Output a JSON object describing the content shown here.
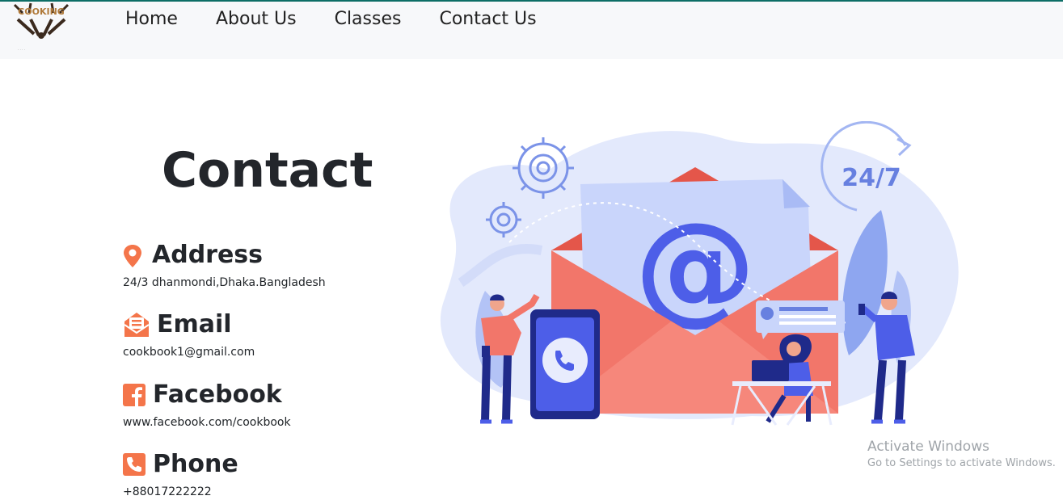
{
  "nav": {
    "logo_text": "COOKING",
    "links": [
      "Home",
      "About Us",
      "Classes",
      "Contact Us"
    ]
  },
  "contact": {
    "title": "Contact",
    "items": [
      {
        "icon": "map-pin-icon",
        "title": "Address",
        "text": "24/3 dhanmondi,Dhaka.Bangladesh"
      },
      {
        "icon": "envelope-icon",
        "title": "Email",
        "text": "cookbook1@gmail.com"
      },
      {
        "icon": "facebook-icon",
        "title": "Facebook",
        "text": "www.facebook.com/cookbook"
      },
      {
        "icon": "phone-icon",
        "title": "Phone",
        "text": "+88017222222"
      }
    ],
    "accent_color": "#f4754a"
  },
  "illustration": {
    "badge": "24/7",
    "symbol": "@"
  },
  "watermark": {
    "line1": "Activate Windows",
    "line2": "Go to Settings to activate Windows."
  }
}
